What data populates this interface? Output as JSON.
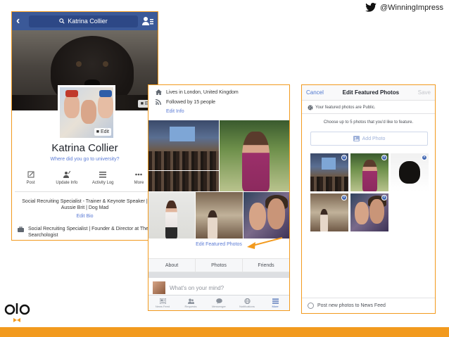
{
  "twitter": {
    "handle": "@WinningImpress"
  },
  "profile": {
    "search_text": "Katrina Collier",
    "cover_edit": "Edit",
    "avatar_edit": "Edit",
    "name": "Katrina Collier",
    "where_prompt": "Where did you go to university?",
    "actions": [
      {
        "label": "Post",
        "icon": "pencil-icon"
      },
      {
        "label": "Update Info",
        "icon": "update-info-icon"
      },
      {
        "label": "Activity Log",
        "icon": "list-icon"
      },
      {
        "label": "More",
        "icon": "more-dots-icon"
      }
    ],
    "bio": "Social Recruiting Specialist - Trainer & Keynote Speaker | Aussie Brit | Dog Mad",
    "edit_bio": "Edit Bio",
    "work": "Social Recruiting Specialist | Founder & Director at The Searchologist"
  },
  "intro": {
    "lives_in": "Lives in London, United Kingdom",
    "followed_by": "Followed by 15 people",
    "edit_info": "Edit Info",
    "edit_featured": "Edit Featured Photos",
    "tabs": [
      "About",
      "Photos",
      "Friends"
    ],
    "compose_placeholder": "What's on your mind?",
    "tabbar": [
      {
        "label": "News Feed",
        "icon": "news-feed-icon"
      },
      {
        "label": "Requests",
        "icon": "friend-requests-icon"
      },
      {
        "label": "Messenger",
        "icon": "messenger-icon"
      },
      {
        "label": "Notifications",
        "icon": "globe-icon"
      },
      {
        "label": "More",
        "icon": "menu-icon",
        "active": true
      }
    ]
  },
  "edit_featured": {
    "cancel": "Cancel",
    "title": "Edit Featured Photos",
    "save": "Save",
    "public_note": "Your featured photos are Public.",
    "choose": "Choose up to 5 photos that you'd like to feature.",
    "add_photo": "Add Photo",
    "post_option": "Post new photos to News Feed",
    "selected_count": 5
  },
  "colors": {
    "accent_orange": "#f29a1e",
    "facebook_blue": "#3b5998",
    "link_blue": "#5b7bd5"
  }
}
